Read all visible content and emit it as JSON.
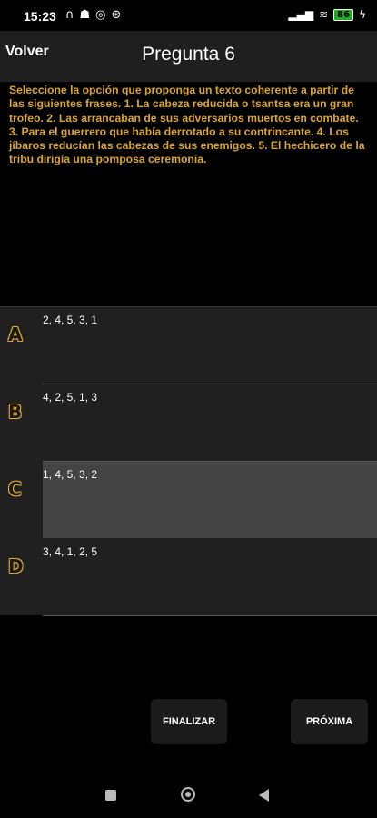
{
  "status": {
    "time": "15:23",
    "battery": "86"
  },
  "header": {
    "back_label": "Volver",
    "title": "Pregunta 6"
  },
  "question": {
    "text": "Seleccione la opción que proponga un texto coherente a partir de las siguientes frases. 1. La cabeza reducida o tsantsa era un gran trofeo. 2. Las arrancaban de sus adversarios muertos en combate. 3. Para el guerrero que había derrotado a su contrincante. 4. Los jíbaros reducían las cabezas de sus enemigos. 5. El hechicero de la tribu dirigía una pomposa ceremonia."
  },
  "options": [
    {
      "letter": "A",
      "text": "2, 4, 5, 3, 1",
      "selected": false
    },
    {
      "letter": "B",
      "text": "4, 2, 5, 1, 3",
      "selected": false
    },
    {
      "letter": "C",
      "text": "1, 4, 5, 3, 2",
      "selected": true
    },
    {
      "letter": "D",
      "text": "3, 4, 1, 2, 5",
      "selected": false
    }
  ],
  "buttons": {
    "finalizar": "FINALIZAR",
    "proxima": "PRÓXIMA"
  },
  "colors": {
    "accent": "#d8a52f",
    "selected_bg": "#444444"
  }
}
